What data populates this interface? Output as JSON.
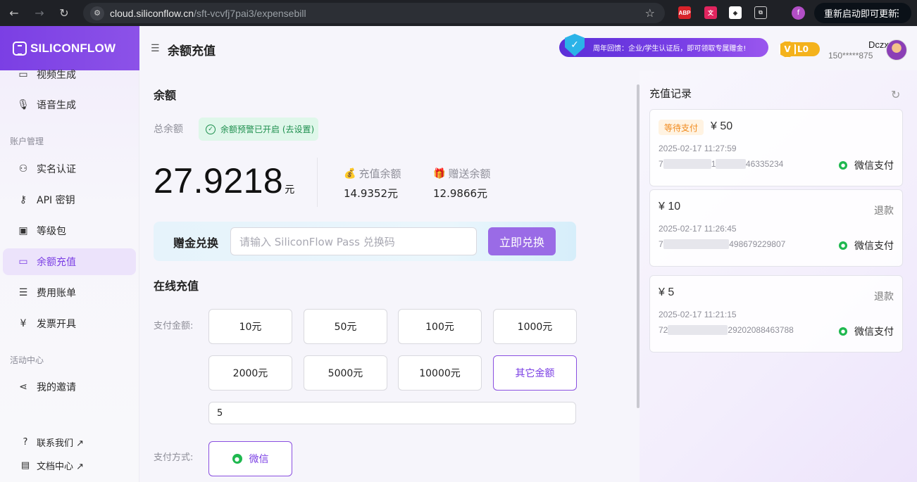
{
  "browser": {
    "url_host": "cloud.siliconflow.cn",
    "url_path": "/sft-vcvfj7pai3/expensebill",
    "profile_initial": "f",
    "update_label": "重新启动即可更新",
    "ext_abp": "ABP"
  },
  "brand": {
    "name": "SILICONFLOW",
    "accent": "#7b3fe4"
  },
  "sidebar": {
    "items_top": [
      {
        "label": "视频生成",
        "icon": "video-icon"
      },
      {
        "label": "语音生成",
        "icon": "mic-icon"
      }
    ],
    "section_account": "账户管理",
    "items_account": [
      {
        "label": "实名认证",
        "icon": "user-icon"
      },
      {
        "label": "API 密钥",
        "icon": "key-icon"
      },
      {
        "label": "等级包",
        "icon": "package-icon"
      },
      {
        "label": "余额充值",
        "icon": "card-icon"
      },
      {
        "label": "费用账单",
        "icon": "bill-icon"
      },
      {
        "label": "发票开具",
        "icon": "invoice-icon"
      }
    ],
    "section_activity": "活动中心",
    "items_activity": [
      {
        "label": "我的邀请",
        "icon": "share-icon"
      }
    ],
    "bottom_links": [
      {
        "label": "联系我们 ↗",
        "icon": "help-icon"
      },
      {
        "label": "文档中心 ↗",
        "icon": "doc-icon"
      }
    ]
  },
  "header": {
    "title": "余额充值",
    "promo_text": "周年回馈：企业/学生认证后，即可领取专属赠金!",
    "level": "L0",
    "level_badge": "V",
    "user_name": "Dczx",
    "user_phone": "150*****875"
  },
  "balance": {
    "heading": "余额",
    "total_label": "总余额",
    "alert_text": "余额预警已开启 (去设置)",
    "total_value": "27.9218",
    "unit": "元",
    "recharge_label": "充值余额",
    "recharge_value": "14.9352元",
    "gift_label": "赠送余额",
    "gift_value": "12.9866元"
  },
  "redeem": {
    "label": "赠金兑换",
    "placeholder": "请输入 SiliconFlow Pass 兑换码",
    "button": "立即兑换"
  },
  "online": {
    "heading": "在线充值",
    "amount_label": "支付金额:",
    "amounts": [
      "10元",
      "50元",
      "100元",
      "1000元",
      "2000元",
      "5000元",
      "10000元",
      "其它金额"
    ],
    "selected_index": 7,
    "custom_value": "5",
    "method_label": "支付方式:",
    "method": "微信"
  },
  "records": {
    "title": "充值记录",
    "items": [
      {
        "status": "等待支付",
        "amount": "¥ 50",
        "refund": "",
        "time": "2025-02-17 11:27:59",
        "order_head": "7",
        "order_mid": "1",
        "order_tail": "46335234",
        "paytype": "微信支付"
      },
      {
        "status": "",
        "amount": "¥ 10",
        "refund": "退款",
        "time": "2025-02-17 11:26:45",
        "order_head": "7",
        "order_mid": "",
        "order_tail": "498679229807",
        "paytype": "微信支付"
      },
      {
        "status": "",
        "amount": "¥ 5",
        "refund": "退款",
        "time": "2025-02-17 11:21:15",
        "order_head": "72",
        "order_mid": "",
        "order_tail": "29202088463788",
        "paytype": "微信支付"
      }
    ]
  }
}
